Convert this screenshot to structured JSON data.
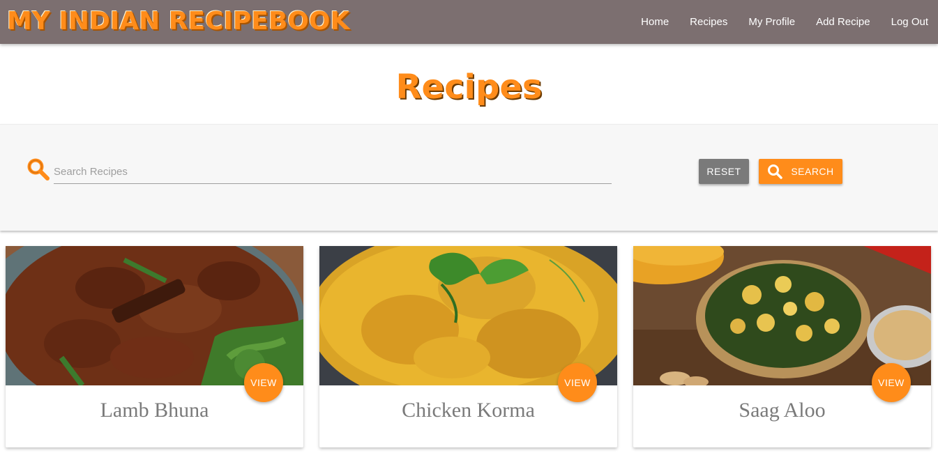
{
  "brand": "MY INDIAN RECIPEBOOK",
  "nav": [
    "Home",
    "Recipes",
    "My Profile",
    "Add Recipe",
    "Log Out"
  ],
  "page_title": "Recipes",
  "search": {
    "placeholder": "Search Recipes",
    "value": ""
  },
  "buttons": {
    "reset": "RESET",
    "search": "SEARCH"
  },
  "recipes": [
    {
      "title": "Lamb Bhuna",
      "view": "VIEW",
      "image": "lamb-bhuna-photo"
    },
    {
      "title": "Chicken Korma",
      "view": "VIEW",
      "image": "chicken-korma-photo"
    },
    {
      "title": "Saag Aloo",
      "view": "VIEW",
      "image": "saag-aloo-photo"
    }
  ],
  "colors": {
    "navbar": "#7c6f70",
    "accent": "#ff8c1a",
    "reset": "#7a7a7a"
  },
  "icons": {
    "search": "search-icon"
  }
}
